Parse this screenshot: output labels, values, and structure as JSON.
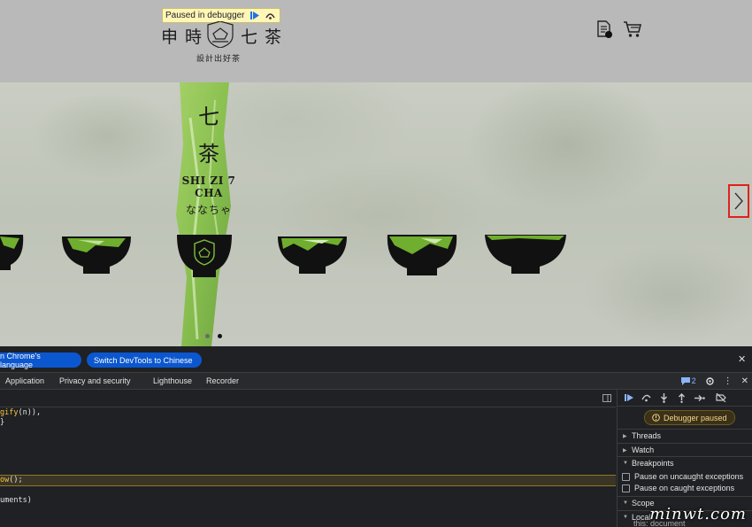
{
  "header": {
    "debugger_label": "Paused in debugger",
    "logo_chars": [
      "申",
      "時",
      "七",
      "茶"
    ],
    "logo_subtitle": "設計出好茶",
    "icons": [
      "document-icon",
      "cart-icon"
    ]
  },
  "hero": {
    "brush_text_1": "七",
    "brush_text_2": "茶",
    "brand_latin": "SHI ZI 7 CHA",
    "brand_kana": "ななちゃ",
    "slide_count": 2,
    "active_slide": 2
  },
  "devtools": {
    "infobar": {
      "lang_button_1": "n Chrome's language",
      "lang_button_2": "Switch DevTools to Chinese"
    },
    "tabs": [
      "Application",
      "Privacy and security",
      "Lighthouse",
      "Recorder"
    ],
    "issues_count": "2",
    "code_lines": {
      "line1_fn": "gify",
      "line1_rest": "(n)),",
      "line2": "}",
      "line3_fn": "ow",
      "line3_rest": "();",
      "line4": "uments)"
    },
    "debugger": {
      "paused_label": "Debugger paused",
      "sections": {
        "threads": "Threads",
        "watch": "Watch",
        "breakpoints": "Breakpoints",
        "scope": "Scope",
        "local": "Local",
        "this_row": "this: document"
      },
      "checkboxes": {
        "uncaught": "Pause on uncaught exceptions",
        "caught": "Pause on caught exceptions"
      }
    }
  },
  "watermark": "minwt.com"
}
